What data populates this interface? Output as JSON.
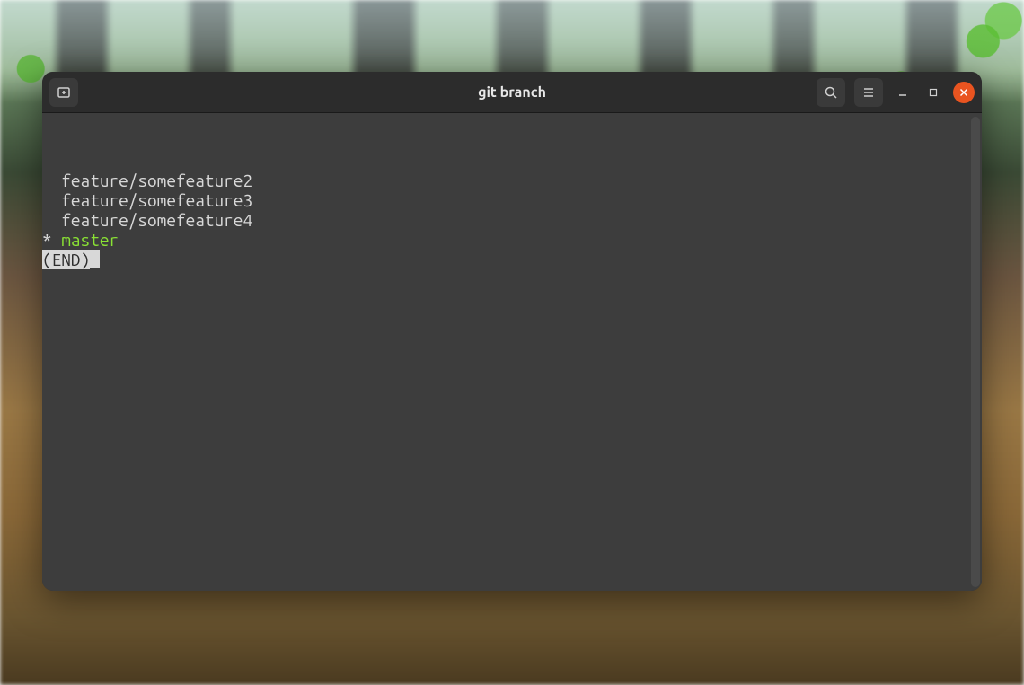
{
  "window": {
    "title": "git branch"
  },
  "terminal": {
    "branches": [
      "feature/somefeature2",
      "feature/somefeature3",
      "feature/somefeature4"
    ],
    "current_marker": "*",
    "current_branch": "master",
    "end_marker": "(END)"
  },
  "icons": {
    "new_tab": "new-tab",
    "search": "search",
    "menu": "menu",
    "minimize": "minimize",
    "maximize": "maximize",
    "close": "close"
  }
}
